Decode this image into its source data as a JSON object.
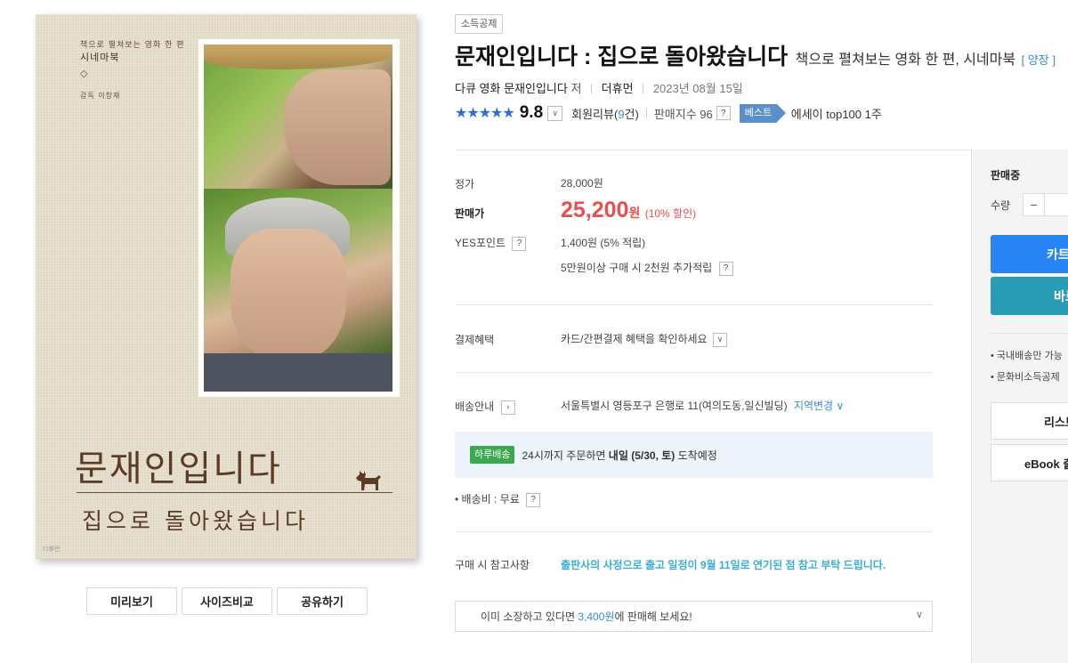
{
  "cover": {
    "subtitle_small": "책으로 펼쳐보는 영화 한 편",
    "series": "시네마북",
    "diamond": "◇",
    "director": "감독 이창재",
    "title": "문재인입니다",
    "subtitle": "집으로 돌아왔습니다",
    "publisher_mark": "더휴먼"
  },
  "cover_buttons": [
    "미리보기",
    "사이즈비교",
    "공유하기"
  ],
  "product": {
    "tag": "소득공제",
    "title": "문재인입니다 : 집으로 돌아왔습니다",
    "subtitle": "책으로 펼쳐보는 영화 한 편, 시네마북",
    "binding": "[ 양장 ]",
    "author": "다큐 영화 문재인입니다",
    "author_role": "저",
    "publisher": "더휴먼",
    "date": "2023년 08월 15일"
  },
  "rating": {
    "stars": "★★★★★",
    "score": "9.8",
    "review_prefix": "회원리뷰(",
    "review_count": "9",
    "review_suffix": "건)",
    "sales_index": "판매지수 96",
    "best_label": "베스트",
    "best_text": "에세이 top100 1주"
  },
  "pricing": {
    "list_label": "정가",
    "list_price": "28,000원",
    "sale_label": "판매가",
    "sale_price": "25,200",
    "sale_won": "원",
    "discount": "(10% 할인)",
    "points_label": "YES포인트",
    "points_value": "1,400원 (5% 적립)",
    "points_extra": "5만원이상 구매 시 2천원 추가적립"
  },
  "payment": {
    "label": "결제혜택",
    "value": "카드/간편결제 혜택을 확인하세요"
  },
  "shipping": {
    "label": "배송안내",
    "address": "서울특별시 영등포구 은행로 11(여의도동,일신빌딩)",
    "region_change": "지역변경",
    "badge": "하루배송",
    "delivery_pre": "24시까지 주문하면",
    "delivery_bold": "내일 (5/30, 토)",
    "delivery_post": "도착예정",
    "fee": "배송비 : 무료"
  },
  "notice": {
    "label": "구매 시 참고사항",
    "text": "출판사의 사정으로 출고 일정이 9월 11일로 연기된 점 참고 부탁 드립니다."
  },
  "sell_prompt": {
    "pre": "이미 소장하고 있다면",
    "amount": "3,400원",
    "post": "에 판매해 보세요!"
  },
  "buy_panel": {
    "status": "판매중",
    "qty_label": "수량",
    "cart": "카트",
    "buy": "바로",
    "note1": "국내배송만 가능",
    "note2": "문화비소득공제",
    "list": "리스트",
    "ebook": "eBook 출"
  },
  "colors": {
    "accent_blue": "#2684f5",
    "sale_red": "#e94f4f",
    "badge_green": "#3aa84d",
    "notice_cyan": "#3aaed8"
  }
}
